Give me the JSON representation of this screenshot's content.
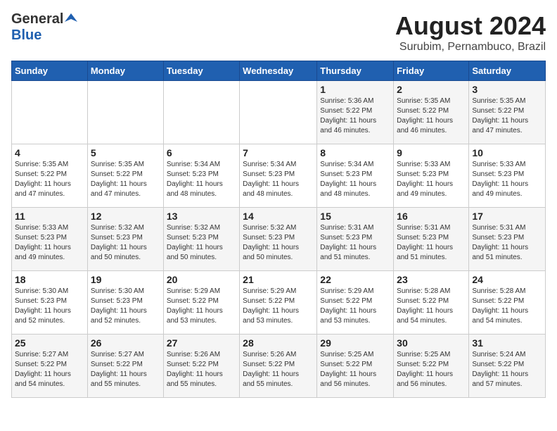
{
  "header": {
    "logo_general": "General",
    "logo_blue": "Blue",
    "title": "August 2024",
    "subtitle": "Surubim, Pernambuco, Brazil"
  },
  "days_of_week": [
    "Sunday",
    "Monday",
    "Tuesday",
    "Wednesday",
    "Thursday",
    "Friday",
    "Saturday"
  ],
  "weeks": [
    [
      {
        "day": "",
        "info": ""
      },
      {
        "day": "",
        "info": ""
      },
      {
        "day": "",
        "info": ""
      },
      {
        "day": "",
        "info": ""
      },
      {
        "day": "1",
        "info": "Sunrise: 5:36 AM\nSunset: 5:22 PM\nDaylight: 11 hours\nand 46 minutes."
      },
      {
        "day": "2",
        "info": "Sunrise: 5:35 AM\nSunset: 5:22 PM\nDaylight: 11 hours\nand 46 minutes."
      },
      {
        "day": "3",
        "info": "Sunrise: 5:35 AM\nSunset: 5:22 PM\nDaylight: 11 hours\nand 47 minutes."
      }
    ],
    [
      {
        "day": "4",
        "info": "Sunrise: 5:35 AM\nSunset: 5:22 PM\nDaylight: 11 hours\nand 47 minutes."
      },
      {
        "day": "5",
        "info": "Sunrise: 5:35 AM\nSunset: 5:22 PM\nDaylight: 11 hours\nand 47 minutes."
      },
      {
        "day": "6",
        "info": "Sunrise: 5:34 AM\nSunset: 5:23 PM\nDaylight: 11 hours\nand 48 minutes."
      },
      {
        "day": "7",
        "info": "Sunrise: 5:34 AM\nSunset: 5:23 PM\nDaylight: 11 hours\nand 48 minutes."
      },
      {
        "day": "8",
        "info": "Sunrise: 5:34 AM\nSunset: 5:23 PM\nDaylight: 11 hours\nand 48 minutes."
      },
      {
        "day": "9",
        "info": "Sunrise: 5:33 AM\nSunset: 5:23 PM\nDaylight: 11 hours\nand 49 minutes."
      },
      {
        "day": "10",
        "info": "Sunrise: 5:33 AM\nSunset: 5:23 PM\nDaylight: 11 hours\nand 49 minutes."
      }
    ],
    [
      {
        "day": "11",
        "info": "Sunrise: 5:33 AM\nSunset: 5:23 PM\nDaylight: 11 hours\nand 49 minutes."
      },
      {
        "day": "12",
        "info": "Sunrise: 5:32 AM\nSunset: 5:23 PM\nDaylight: 11 hours\nand 50 minutes."
      },
      {
        "day": "13",
        "info": "Sunrise: 5:32 AM\nSunset: 5:23 PM\nDaylight: 11 hours\nand 50 minutes."
      },
      {
        "day": "14",
        "info": "Sunrise: 5:32 AM\nSunset: 5:23 PM\nDaylight: 11 hours\nand 50 minutes."
      },
      {
        "day": "15",
        "info": "Sunrise: 5:31 AM\nSunset: 5:23 PM\nDaylight: 11 hours\nand 51 minutes."
      },
      {
        "day": "16",
        "info": "Sunrise: 5:31 AM\nSunset: 5:23 PM\nDaylight: 11 hours\nand 51 minutes."
      },
      {
        "day": "17",
        "info": "Sunrise: 5:31 AM\nSunset: 5:23 PM\nDaylight: 11 hours\nand 51 minutes."
      }
    ],
    [
      {
        "day": "18",
        "info": "Sunrise: 5:30 AM\nSunset: 5:23 PM\nDaylight: 11 hours\nand 52 minutes."
      },
      {
        "day": "19",
        "info": "Sunrise: 5:30 AM\nSunset: 5:23 PM\nDaylight: 11 hours\nand 52 minutes."
      },
      {
        "day": "20",
        "info": "Sunrise: 5:29 AM\nSunset: 5:22 PM\nDaylight: 11 hours\nand 53 minutes."
      },
      {
        "day": "21",
        "info": "Sunrise: 5:29 AM\nSunset: 5:22 PM\nDaylight: 11 hours\nand 53 minutes."
      },
      {
        "day": "22",
        "info": "Sunrise: 5:29 AM\nSunset: 5:22 PM\nDaylight: 11 hours\nand 53 minutes."
      },
      {
        "day": "23",
        "info": "Sunrise: 5:28 AM\nSunset: 5:22 PM\nDaylight: 11 hours\nand 54 minutes."
      },
      {
        "day": "24",
        "info": "Sunrise: 5:28 AM\nSunset: 5:22 PM\nDaylight: 11 hours\nand 54 minutes."
      }
    ],
    [
      {
        "day": "25",
        "info": "Sunrise: 5:27 AM\nSunset: 5:22 PM\nDaylight: 11 hours\nand 54 minutes."
      },
      {
        "day": "26",
        "info": "Sunrise: 5:27 AM\nSunset: 5:22 PM\nDaylight: 11 hours\nand 55 minutes."
      },
      {
        "day": "27",
        "info": "Sunrise: 5:26 AM\nSunset: 5:22 PM\nDaylight: 11 hours\nand 55 minutes."
      },
      {
        "day": "28",
        "info": "Sunrise: 5:26 AM\nSunset: 5:22 PM\nDaylight: 11 hours\nand 55 minutes."
      },
      {
        "day": "29",
        "info": "Sunrise: 5:25 AM\nSunset: 5:22 PM\nDaylight: 11 hours\nand 56 minutes."
      },
      {
        "day": "30",
        "info": "Sunrise: 5:25 AM\nSunset: 5:22 PM\nDaylight: 11 hours\nand 56 minutes."
      },
      {
        "day": "31",
        "info": "Sunrise: 5:24 AM\nSunset: 5:22 PM\nDaylight: 11 hours\nand 57 minutes."
      }
    ]
  ]
}
